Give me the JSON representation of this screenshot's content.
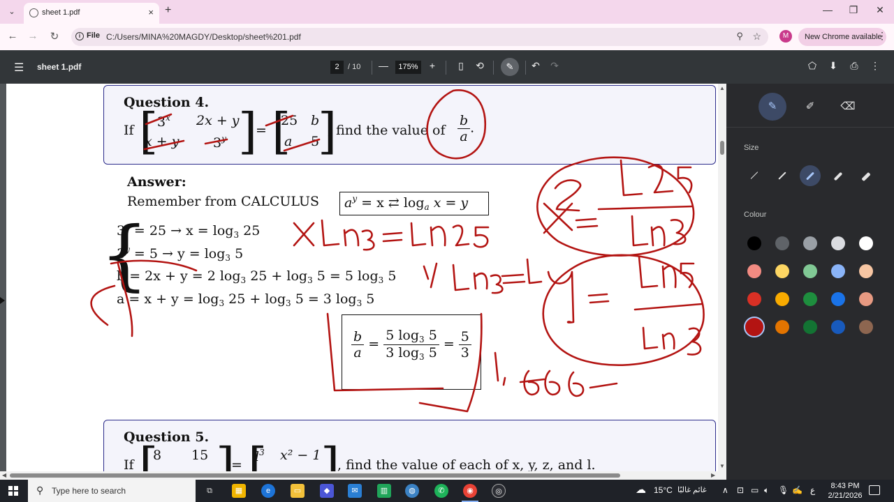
{
  "browser": {
    "tab_title": "sheet 1.pdf",
    "tab_close": "×",
    "new_tab": "+",
    "tab_search": "⌄",
    "window_controls": {
      "minimize": "—",
      "maximize": "❐",
      "close": "✕"
    },
    "nav": {
      "back": "←",
      "forward": "→",
      "reload": "↻"
    },
    "site_chip": "File",
    "url": "C:/Users/MINA%20MAGDY/Desktop/sheet%201.pdf",
    "zoom_icon": "⚲",
    "star_icon": "☆",
    "profile_initial": "M",
    "update_label": "New Chrome available",
    "menu_icon": "⋮"
  },
  "pdf_toolbar": {
    "menu_icon": "☰",
    "doc_title": "sheet 1.pdf",
    "current_page": "2",
    "page_count": "/ 10",
    "zoom_out": "—",
    "zoom_value": "175%",
    "zoom_in": "+",
    "fit_icon": "▯",
    "rotate_icon": "⟲",
    "annotate_icon": "✎",
    "undo_icon": "↶",
    "redo_icon": "↷",
    "save_icon": "⬇",
    "print_icon": "⎙",
    "more_icon": "⋮",
    "annot_add_icon": "⬠"
  },
  "document": {
    "q4": {
      "title": "Question 4.",
      "if": "If",
      "m11": "3",
      "m11_sup": "x",
      "m12": "2x + y",
      "m21": "x + y",
      "m22": "3",
      "m22_sup": "y",
      "eq": "=",
      "r11": "25",
      "r12": "b",
      "r21": "a",
      "r22": "5",
      "find": ", find the value of",
      "frac_num": "b",
      "frac_den": "a",
      "period": "."
    },
    "answer": {
      "heading": "Answer:",
      "remember": "Remember from CALCULUS",
      "identity_a": "a",
      "identity_sup": "y",
      "identity_rest": "= x ⇄ log",
      "identity_sub": "a",
      "identity_end": "x = y",
      "line1_a": "3",
      "line1_sup": "x",
      "line1_b": "= 25 → x = log",
      "line1_sub": "3",
      "line1_c": "25",
      "line2_a": "3",
      "line2_sup": "y",
      "line2_b": "= 5 → y = log",
      "line2_sub": "3",
      "line2_c": "5",
      "line3_a": "b = 2x + y = 2 log",
      "line3_s1": "3",
      "line3_b": "25 + log",
      "line3_s2": "3",
      "line3_c": "5 = 5 log",
      "line3_s3": "3",
      "line3_d": "5",
      "line4_a": "a = x + y = log",
      "line4_s1": "3",
      "line4_b": "25 + log",
      "line4_s2": "3",
      "line4_c": "5 = 3 log",
      "line4_s3": "3",
      "line4_d": "5",
      "result_num1": "b",
      "result_den1": "a",
      "result_eq": "=",
      "result_num2a": "5 log",
      "result_num2s": "3",
      "result_num2b": "5",
      "result_den2a": "3 log",
      "result_den2s": "3",
      "result_den2b": "5",
      "result_eq2": "=",
      "result_num3": "5",
      "result_den3": "3"
    },
    "q5": {
      "title": "Question 5.",
      "if": "If",
      "m11": "8",
      "m12": "15",
      "r11": "l",
      "r11_sup": "3",
      "r12": "x² − 1",
      "eq": "=",
      "find": ", find the value of each of x, y, z, and l."
    }
  },
  "annotation_panel": {
    "size_label": "Size",
    "colour_label": "Colour",
    "tools": [
      "pen-icon",
      "highlighter-icon",
      "eraser-icon"
    ],
    "active_tool": "pen",
    "selected_size_index": 2,
    "colours": [
      [
        "#000000",
        "#5f6368",
        "#9aa0a6",
        "#dadce0",
        "#ffffff"
      ],
      [
        "#f28b82",
        "#fdd663",
        "#81c995",
        "#8ab4f8",
        "#f7c6a3"
      ],
      [
        "#d93025",
        "#f9ab00",
        "#1e8e3e",
        "#1a73e8",
        "#e79a82"
      ],
      [
        "#b31412",
        "#e37400",
        "#137333",
        "#185abc",
        "#8d6650"
      ]
    ],
    "selected_colour": "#b31412"
  },
  "taskbar": {
    "search_placeholder": "Type here to search",
    "weather": "15°C",
    "weather_text": "غائم غالبًا",
    "lang": "ع",
    "time": "8:43 PM",
    "date": "2/21/2026"
  }
}
